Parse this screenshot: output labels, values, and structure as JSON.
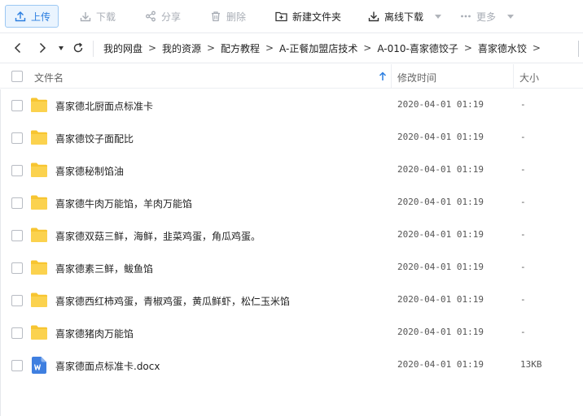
{
  "toolbar": {
    "upload": "上传",
    "download": "下载",
    "share": "分享",
    "delete": "删除",
    "new_folder": "新建文件夹",
    "offline_download": "离线下载",
    "more": "更多"
  },
  "breadcrumb": {
    "items": [
      "我的网盘",
      "我的资源",
      "配方教程",
      "A-正餐加盟店技术",
      "A-010-喜家德饺子",
      "喜家德水饺"
    ],
    "separator": ">"
  },
  "columns": {
    "name": "文件名",
    "modified": "修改时间",
    "size": "大小"
  },
  "files": [
    {
      "name": "喜家德北厨面点标准卡",
      "modified": "2020-04-01 01:19",
      "size": "-",
      "type": "folder"
    },
    {
      "name": "喜家德饺子面配比",
      "modified": "2020-04-01 01:19",
      "size": "-",
      "type": "folder"
    },
    {
      "name": "喜家德秘制馅油",
      "modified": "2020-04-01 01:19",
      "size": "-",
      "type": "folder"
    },
    {
      "name": "喜家德牛肉万能馅，羊肉万能馅",
      "modified": "2020-04-01 01:19",
      "size": "-",
      "type": "folder"
    },
    {
      "name": "喜家德双菇三鲜，海鲜，韭菜鸡蛋，角瓜鸡蛋。",
      "modified": "2020-04-01 01:19",
      "size": "-",
      "type": "folder"
    },
    {
      "name": "喜家德素三鲜，鲅鱼馅",
      "modified": "2020-04-01 01:19",
      "size": "-",
      "type": "folder"
    },
    {
      "name": "喜家德西红柿鸡蛋，青椒鸡蛋，黄瓜鲜虾，松仁玉米馅",
      "modified": "2020-04-01 01:19",
      "size": "-",
      "type": "folder"
    },
    {
      "name": "喜家德猪肉万能馅",
      "modified": "2020-04-01 01:19",
      "size": "-",
      "type": "folder"
    },
    {
      "name": "喜家德面点标准卡.docx",
      "modified": "2020-04-01 01:19",
      "size": "13KB",
      "type": "docx"
    }
  ],
  "colors": {
    "accent": "#2b7ee0",
    "folder": "#f7c531",
    "word": "#3f7fe0"
  }
}
